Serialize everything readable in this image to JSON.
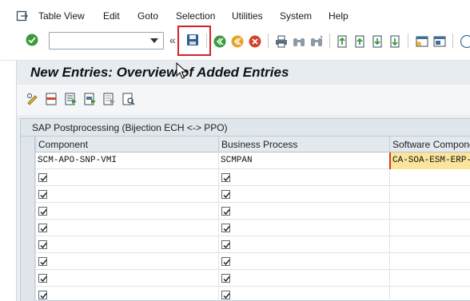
{
  "menu": {
    "items": [
      "Table View",
      "Edit",
      "Goto",
      "Selection",
      "Utilities",
      "System",
      "Help"
    ]
  },
  "toolbar": {
    "command_field_value": "",
    "icons": [
      "enter-check-icon",
      "save-icon",
      "back-icon",
      "exit-icon",
      "cancel-icon",
      "print-icon",
      "find-icon",
      "find-next-icon",
      "first-page-icon",
      "previous-page-icon",
      "next-page-icon",
      "last-page-icon",
      "create-session-icon",
      "generate-shortcut-icon",
      "help-icon"
    ]
  },
  "title": "New Entries: Overview of Added Entries",
  "app_toolbar": {
    "icons": [
      "change-display-icon",
      "delete-row-icon",
      "select-all-icon",
      "select-block-icon",
      "deselect-all-icon",
      "print-standard-list-icon"
    ]
  },
  "table": {
    "title": "SAP Postprocessing (Bijection ECH <-> PPO)",
    "columns": [
      "Component",
      "Business Process",
      "Software Component"
    ],
    "rows": [
      {
        "component": "SCM-APO-SNP-VMI",
        "business_process": "SCMPAN",
        "software_component": "CA-SOA-ESM-ERP-"
      },
      {
        "component": "",
        "business_process": "",
        "software_component": ""
      },
      {
        "component": "",
        "business_process": "",
        "software_component": ""
      },
      {
        "component": "",
        "business_process": "",
        "software_component": ""
      },
      {
        "component": "",
        "business_process": "",
        "software_component": ""
      },
      {
        "component": "",
        "business_process": "",
        "software_component": ""
      },
      {
        "component": "",
        "business_process": "",
        "software_component": ""
      },
      {
        "component": "",
        "business_process": "",
        "software_component": ""
      },
      {
        "component": "",
        "business_process": "",
        "software_component": ""
      }
    ]
  },
  "colors": {
    "highlight_red": "#d4202a",
    "required_field": "#fbe59b",
    "title_bg": "#e7ecf1"
  }
}
